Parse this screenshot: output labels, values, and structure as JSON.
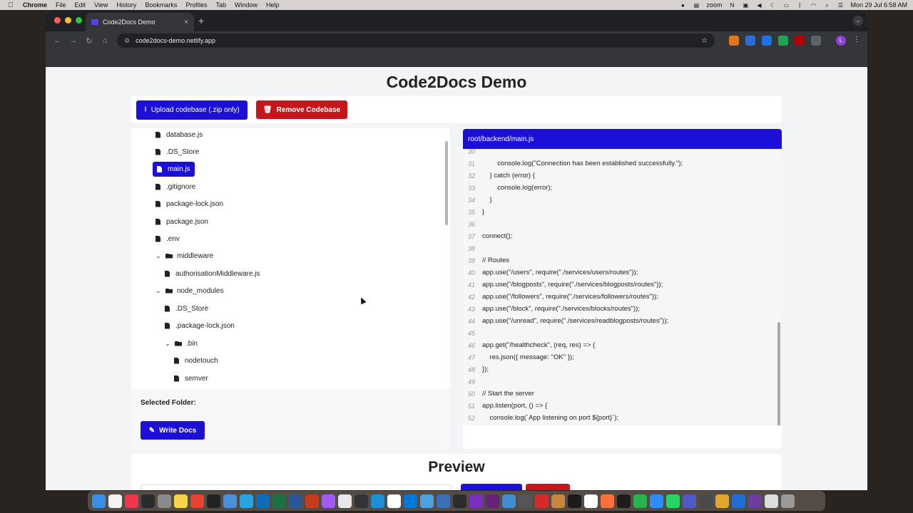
{
  "menubar": {
    "apple": "",
    "app_name": "Chrome",
    "items": [
      "File",
      "Edit",
      "View",
      "History",
      "Bookmarks",
      "Profiles",
      "Tab",
      "Window",
      "Help"
    ],
    "zoom_label": "zoom",
    "datetime": "Mon 29 Jul  6:58 AM"
  },
  "browser": {
    "tab_title": "Code2Docs Demo",
    "tab_close": "×",
    "new_tab": "+",
    "url": "code2docs-demo.netlify.app",
    "profile_initial": "L"
  },
  "page": {
    "title": "Code2Docs Demo",
    "upload_button": "Upload codebase (.zip only)",
    "remove_button": "Remove Codebase",
    "selected_folder_label": "Selected Folder:",
    "write_docs_button": "Write Docs",
    "preview_title": "Preview"
  },
  "tree": {
    "items": [
      {
        "label": "database.js",
        "type": "file"
      },
      {
        "label": ".DS_Store",
        "type": "file"
      },
      {
        "label": "main.js",
        "type": "file",
        "selected": true
      },
      {
        "label": ".gitignore",
        "type": "file"
      },
      {
        "label": "package-lock.json",
        "type": "file"
      },
      {
        "label": "package.json",
        "type": "file"
      },
      {
        "label": ".env",
        "type": "file"
      },
      {
        "label": "middleware",
        "type": "folder"
      },
      {
        "label": "authorisationMiddleware.js",
        "type": "file"
      },
      {
        "label": "node_modules",
        "type": "folder"
      },
      {
        "label": ".DS_Store",
        "type": "file"
      },
      {
        "label": ".package-lock.json",
        "type": "file"
      },
      {
        "label": ".bin",
        "type": "folder"
      },
      {
        "label": "nodetouch",
        "type": "file"
      },
      {
        "label": "semver",
        "type": "file"
      }
    ]
  },
  "code": {
    "path": "root/backend/main.js",
    "lines": [
      {
        "n": "30",
        "text": ""
      },
      {
        "n": "31",
        "text": "        console.log(\"Connection has been established successfully.\");"
      },
      {
        "n": "32",
        "text": "    } catch (error) {"
      },
      {
        "n": "33",
        "text": "        console.log(error);"
      },
      {
        "n": "34",
        "text": "    }"
      },
      {
        "n": "35",
        "text": "}"
      },
      {
        "n": "36",
        "text": ""
      },
      {
        "n": "37",
        "text": "connect();"
      },
      {
        "n": "38",
        "text": ""
      },
      {
        "n": "39",
        "text": "// Routes"
      },
      {
        "n": "40",
        "text": "app.use(\"/users\", require(\"./services/users/routes\"));"
      },
      {
        "n": "41",
        "text": "app.use(\"/blogposts\", require(\"./services/blogposts/routes\"));"
      },
      {
        "n": "42",
        "text": "app.use(\"/followers\", require(\"./services/followers/routes\"));"
      },
      {
        "n": "43",
        "text": "app.use(\"/block\", require(\"./services/blocks/routes\"));"
      },
      {
        "n": "44",
        "text": "app.use(\"/unread\", require(\"./services/readblogposts/routes\"));"
      },
      {
        "n": "45",
        "text": ""
      },
      {
        "n": "46",
        "text": "app.get(\"/healthcheck\", (req, res) => {"
      },
      {
        "n": "47",
        "text": "    res.json({ message: \"OK\" });"
      },
      {
        "n": "48",
        "text": "});"
      },
      {
        "n": "49",
        "text": ""
      },
      {
        "n": "50",
        "text": "// Start the server"
      },
      {
        "n": "51",
        "text": "app.listen(port, () => {"
      },
      {
        "n": "52",
        "text": "    console.log(`App listening on port ${port}`);"
      }
    ]
  },
  "colors": {
    "accent": "#1b0fd8",
    "danger": "#c6161c"
  }
}
